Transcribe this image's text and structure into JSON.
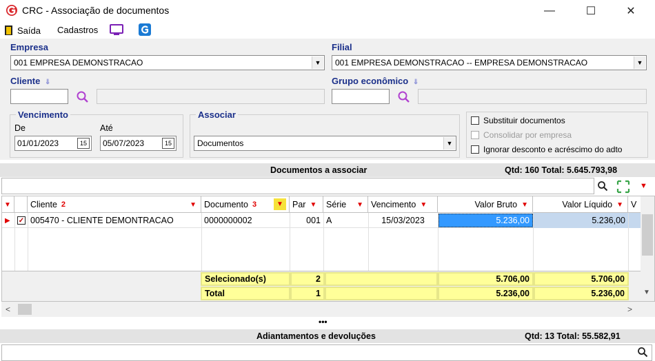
{
  "window": {
    "title": "CRC - Associação de documentos",
    "minimize": "—",
    "maximize": "☐",
    "close": "✕"
  },
  "menu": {
    "exit_label": "Saída",
    "cadastros_label": "Cadastros"
  },
  "empresa": {
    "label": "Empresa",
    "value": "001 EMPRESA DEMONSTRACAO"
  },
  "filial": {
    "label": "Filial",
    "value": "001 EMPRESA DEMONSTRACAO -- EMPRESA DEMONSTRACAO"
  },
  "cliente": {
    "label": "Cliente",
    "code": "",
    "name": ""
  },
  "grupo": {
    "label": "Grupo econômico",
    "code": "",
    "name": ""
  },
  "vencimento": {
    "title": "Vencimento",
    "from_label": "De",
    "from_value": "01/01/2023",
    "to_label": "Até",
    "to_value": "05/07/2023",
    "cal_glyph": "15"
  },
  "associar": {
    "title": "Associar",
    "value": "Documentos"
  },
  "options": [
    {
      "label": "Substituir documentos",
      "checked": false,
      "enabled": true
    },
    {
      "label": "Consolidar por empresa",
      "checked": false,
      "enabled": false
    },
    {
      "label": "Ignorar desconto e acréscimo do adto",
      "checked": false,
      "enabled": true
    }
  ],
  "docs_section": {
    "title": "Documentos a associar",
    "summary": "Qtd: 160 Total: 5.645.793,98"
  },
  "grid": {
    "columns": [
      {
        "label": "Cliente",
        "sort": "2"
      },
      {
        "label": "Documento",
        "sort": "3"
      },
      {
        "label": "Par"
      },
      {
        "label": "Série"
      },
      {
        "label": "Vencimento"
      },
      {
        "label": "Valor Bruto"
      },
      {
        "label": "Valor Líquido"
      },
      {
        "label": "V"
      }
    ],
    "rows": [
      {
        "checked": true,
        "cliente": "005470 - CLIENTE DEMONTRACAO",
        "documento": "0000000002",
        "par": "001",
        "serie": "A",
        "vencimento": "15/03/2023",
        "valor_bruto": "5.236,00",
        "valor_liquido": "5.236,00"
      }
    ],
    "totals": [
      {
        "label": "Selecionado(s)",
        "count": "2",
        "valor_bruto": "5.706,00",
        "valor_liquido": "5.706,00"
      },
      {
        "label": "Total",
        "count": "1",
        "valor_bruto": "5.236,00",
        "valor_liquido": "5.236,00"
      }
    ]
  },
  "splitter": "•••",
  "adiant_section": {
    "title": "Adiantamentos e devoluções",
    "summary": "Qtd: 13 Total: 55.582,91"
  },
  "colors": {
    "label_blue": "#1a2f8a",
    "accent_red": "#e00000",
    "total_yellow": "#ffff99",
    "selected_blue": "#3399ff"
  }
}
